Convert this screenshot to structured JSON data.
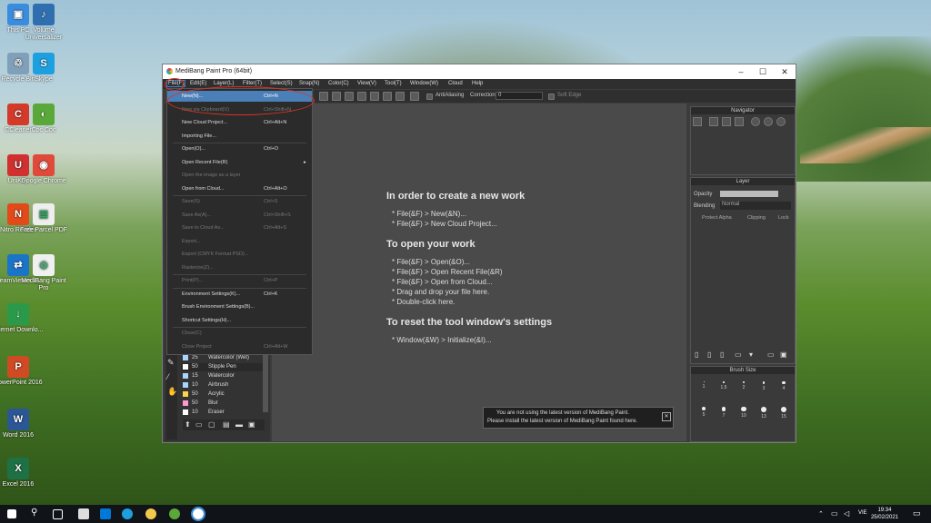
{
  "desktop": {
    "icons": [
      {
        "label": "This PC",
        "color": "#3a8dde",
        "glyph": "▣"
      },
      {
        "label": "Volume Universalizer",
        "color": "#2f6fb0",
        "glyph": "♪"
      },
      {
        "label": "Recycle Bin",
        "color": "#7fa0b8",
        "glyph": "♲"
      },
      {
        "label": "Skype",
        "color": "#1ea0e0",
        "glyph": "S"
      },
      {
        "label": "CCleaner",
        "color": "#d43a2a",
        "glyph": "C"
      },
      {
        "label": "Coc Coc",
        "color": "#5aa83a",
        "glyph": "◐"
      },
      {
        "label": "UniKey",
        "color": "#d03030",
        "glyph": "U"
      },
      {
        "label": "Google Chrome",
        "color": "#e04a3a",
        "glyph": "◉"
      },
      {
        "label": "Nitro Reader",
        "color": "#e24a1a",
        "glyph": "N"
      },
      {
        "label": "Free Parcel PDF",
        "color": "#eeeeee",
        "glyph": "▤"
      },
      {
        "label": "TeamViewer 11",
        "color": "#1a74c8",
        "glyph": "⇄"
      },
      {
        "label": "MediBang Paint Pro",
        "color": "#f0f0f0",
        "glyph": "◎"
      },
      {
        "label": "Internet Downlo...",
        "color": "#2a9a4a",
        "glyph": "↓"
      },
      {
        "label": "PowerPoint 2016",
        "color": "#d04a24",
        "glyph": "P"
      },
      {
        "label": "Word 2016",
        "color": "#2b5797",
        "glyph": "W"
      },
      {
        "label": "Excel 2016",
        "color": "#1e7145",
        "glyph": "X"
      }
    ]
  },
  "window": {
    "title": "MediBang Paint Pro (64bit)",
    "min": "–",
    "max": "☐",
    "close": "✕"
  },
  "menubar": [
    "File(F)",
    "Edit(E)",
    "Layer(L)",
    "Filter(T)",
    "Select(S)",
    "Snap(N)",
    "Color(C)",
    "View(V)",
    "Tool(T)",
    "Window(W)",
    "Cloud",
    "Help"
  ],
  "toolbar": {
    "antialias_label": "AntiAliasing",
    "correction_label": "Correction",
    "correction_value": "0",
    "softedge_label": "Soft Edge"
  },
  "file_menu": {
    "items": [
      {
        "label": "New(N)...",
        "shortcut": "Ctrl+N",
        "disabled": false,
        "selected": true
      },
      {
        "label": "New via Clipboard(V)",
        "shortcut": "Ctrl+Shift+N",
        "disabled": true,
        "selected": false
      },
      {
        "label": "New Cloud Project...",
        "shortcut": "Ctrl+Alt+N",
        "disabled": false,
        "selected": false
      },
      {
        "label": "Importing File...",
        "shortcut": "",
        "disabled": false,
        "selected": false
      },
      {
        "label": "Open(O)...",
        "shortcut": "Ctrl+O",
        "disabled": false,
        "selected": false
      },
      {
        "label": "Open Recent File(R)",
        "shortcut": "▸",
        "disabled": false,
        "selected": false
      },
      {
        "label": "Open the image as a layer",
        "shortcut": "",
        "disabled": true,
        "selected": false
      },
      {
        "label": "Open from Cloud...",
        "shortcut": "Ctrl+Alt+O",
        "disabled": false,
        "selected": false
      },
      {
        "label": "Save(S)",
        "shortcut": "Ctrl+S",
        "disabled": true,
        "selected": false
      },
      {
        "label": "Save As(A)...",
        "shortcut": "Ctrl+Shift+S",
        "disabled": true,
        "selected": false
      },
      {
        "label": "Save to Cloud As...",
        "shortcut": "Ctrl+Alt+S",
        "disabled": true,
        "selected": false
      },
      {
        "label": "Export...",
        "shortcut": "",
        "disabled": true,
        "selected": false
      },
      {
        "label": "Export (CMYK Format PSD)...",
        "shortcut": "",
        "disabled": true,
        "selected": false
      },
      {
        "label": "Rasterize(Z)...",
        "shortcut": "",
        "disabled": true,
        "selected": false
      },
      {
        "label": "Print(P)...",
        "shortcut": "Ctrl+P",
        "disabled": true,
        "selected": false
      },
      {
        "label": "Environment Settings(K)...",
        "shortcut": "Ctrl+K",
        "disabled": false,
        "selected": false
      },
      {
        "label": "Brush Environment Settings(B)...",
        "shortcut": "",
        "disabled": false,
        "selected": false
      },
      {
        "label": "Shortcut Settings(H)...",
        "shortcut": "",
        "disabled": false,
        "selected": false
      },
      {
        "label": "Close(C)",
        "shortcut": "",
        "disabled": true,
        "selected": false
      },
      {
        "label": "Close Project",
        "shortcut": "Ctrl+Alt+W",
        "disabled": true,
        "selected": false
      }
    ]
  },
  "canvas": {
    "h1": "In order to create a new work",
    "l1a": "* File(&F) > New(&N)...",
    "l1b": "* File(&F) > New Cloud Project...",
    "h2": "To open your work",
    "l2a": "* File(&F) > Open(&O)...",
    "l2b": "* File(&F) > Open Recent File(&R)",
    "l2c": "* File(&F) > Open from Cloud...",
    "l2d": "* Drag and drop your file here.",
    "l2e": "* Double-click here.",
    "h3": "To reset the tool window's settings",
    "l3a": "* Window(&W) > Initialize(&I)..."
  },
  "notice": {
    "line1": "You are not using the latest version of MediBang Paint.",
    "line2": "Please install the latest version of MediBang Paint found here.",
    "close": "✕"
  },
  "panels": {
    "navigator": "Navigator",
    "layer": "Layer",
    "opacity_label": "Opacity",
    "blending_label": "Blending",
    "blending_value": "Normal",
    "protect_alpha": "Protect Alpha",
    "clipping": "Clipping",
    "lock": "Lock",
    "brush_size": "Brush Size",
    "brush_sizes_row1": [
      "1",
      "1.5",
      "2",
      "3",
      "4"
    ],
    "brush_sizes_row2": [
      "5",
      "7",
      "10",
      "13",
      "15"
    ]
  },
  "brush_list": [
    {
      "num": "25",
      "name": "Watercolor (Wet)",
      "color": "#aad4ff"
    },
    {
      "num": "50",
      "name": "Stipple Pen",
      "color": "#ffffff"
    },
    {
      "num": "15",
      "name": "Watercolor",
      "color": "#aad4ff"
    },
    {
      "num": "10",
      "name": "Airbrush",
      "color": "#aad4ff"
    },
    {
      "num": "50",
      "name": "Acrylic",
      "color": "#ffd24a"
    },
    {
      "num": "50",
      "name": "Blur",
      "color": "#ff9ad0"
    },
    {
      "num": "10",
      "name": "Eraser",
      "color": "#ffffff"
    }
  ],
  "taskbar": {
    "lang": "VIE",
    "time": "19:34",
    "date": "25/02/2021"
  }
}
